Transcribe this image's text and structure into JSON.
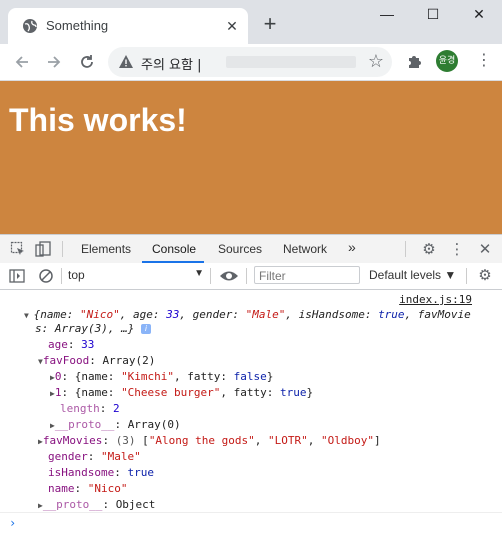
{
  "browser": {
    "tab_title": "Something",
    "new_tab_symbol": "+",
    "tab_close_symbol": "✕",
    "security_status": "주의 요함",
    "address_separator": "|",
    "profile_initials": "윤경",
    "window_controls": {
      "minimize": "—",
      "maximize": "☐",
      "close": "✕"
    }
  },
  "page": {
    "heading": "This works!",
    "background_color": "#cd853f"
  },
  "devtools": {
    "tabs": [
      "Elements",
      "Console",
      "Sources",
      "Network"
    ],
    "active_tab": "Console",
    "more_tabs": "»",
    "context": "top",
    "filter_placeholder": "Filter",
    "levels_label": "Default levels ▼"
  },
  "console": {
    "source_link": "index.js:19",
    "summary_prefix": "{name: ",
    "summary_name": "\"Nico\"",
    "summary_age_key": ", age: ",
    "summary_age": "33",
    "summary_gender_key": ", gender: ",
    "summary_gender": "\"Male\"",
    "summary_hs_key": ", isHandsome: ",
    "summary_hs": "true",
    "summary_tail": ", favMovie",
    "summary_line2": "s: Array(3), …}",
    "info_badge": "i",
    "age_key": "age",
    "age_value": "33",
    "favfood_key": "favFood",
    "favfood_value": "Array(2)",
    "food0_idx": "0",
    "food0_name": "\"Kimchi\"",
    "food0_fatty": "false",
    "food1_idx": "1",
    "food1_name": "\"Cheese burger\"",
    "food1_fatty": "true",
    "length_key": "length",
    "length_value": "2",
    "proto_key": "__proto__",
    "food_proto_value": "Array(0)",
    "favmovies_key": "favMovies",
    "favmovies_count": "(3)",
    "movie1": "\"Along the gods\"",
    "movie2": "\"LOTR\"",
    "movie3": "\"Oldboy\"",
    "gender_key": "gender",
    "gender_value": "\"Male\"",
    "ishandsome_key": "isHandsome",
    "ishandsome_value": "true",
    "name_key": "name",
    "name_value": "\"Nico\"",
    "obj_proto_value": "Object",
    "prompt_symbol": "›"
  }
}
